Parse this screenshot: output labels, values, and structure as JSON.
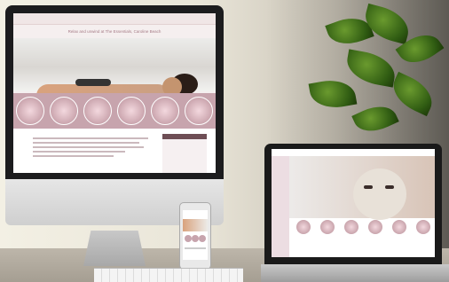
{
  "imac": {
    "site_title": "Relax and unwind at The Essentials, Caroline Beach",
    "logo_icon": "apple-logo-icon"
  },
  "colors": {
    "brand_pink": "#c7a4ad",
    "brand_dark": "#6e4e55"
  }
}
